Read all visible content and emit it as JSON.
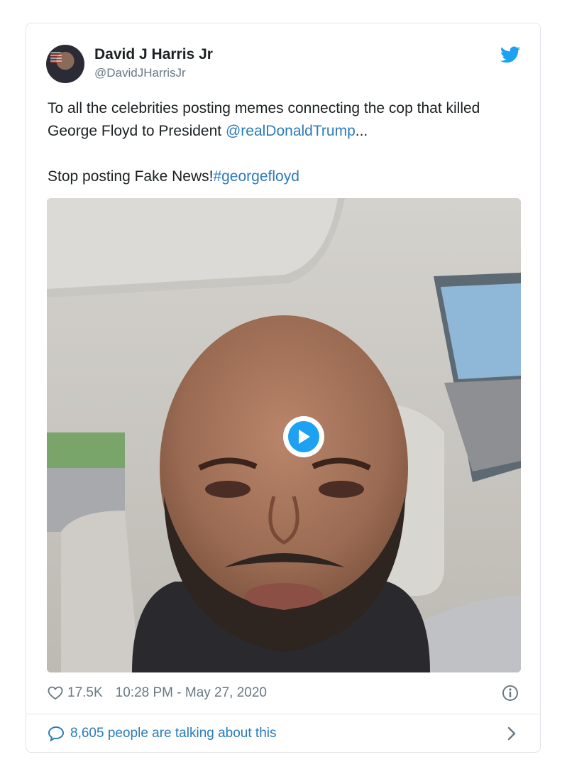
{
  "tweet": {
    "author_name": "David J Harris Jr",
    "author_handle": "@DavidJHarrisJr",
    "text_part1": "To all the celebrities posting memes connecting the cop that killed George Floyd to President ",
    "mention": "@realDonaldTrump",
    "ellipsis": "...",
    "text_part2": "Stop posting Fake News!",
    "hashtag": "#georgefloyd",
    "likes": "17.5K",
    "timestamp": "10:28 PM - May 27, 2020",
    "talking": "8,605 people are talking about this"
  },
  "icons": {
    "brand": "twitter-bird-icon",
    "like": "heart-icon",
    "info": "info-icon",
    "reply": "speech-bubble-icon",
    "chevron": "chevron-right-icon",
    "play": "play-icon"
  },
  "colors": {
    "brand": "#1da1f2",
    "link": "#2b7bb9",
    "muted": "#697882"
  }
}
